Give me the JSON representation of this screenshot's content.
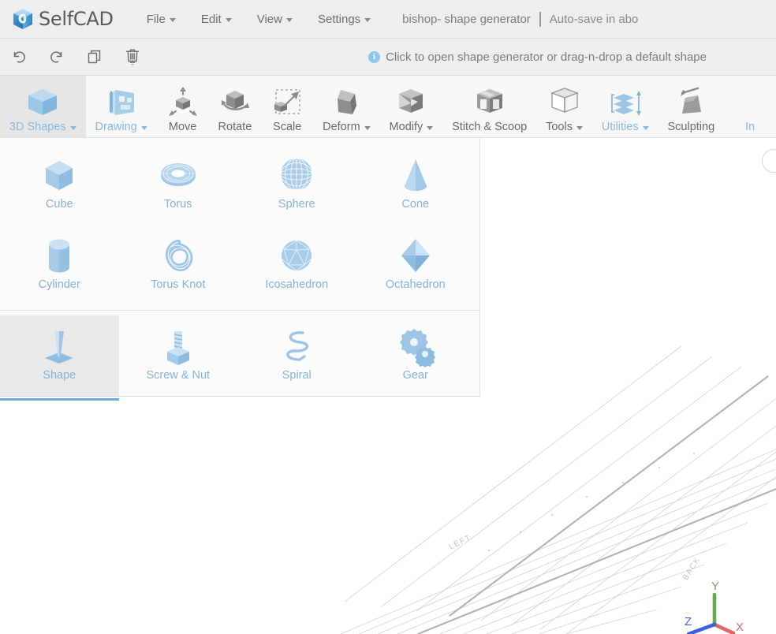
{
  "app": {
    "brand_name": "SelfCAD",
    "logo_icon": "selfcad-cube-logo"
  },
  "menubar": {
    "items": [
      {
        "label": "File",
        "has_caret": true,
        "name": "menu-file"
      },
      {
        "label": "Edit",
        "has_caret": true,
        "name": "menu-edit"
      },
      {
        "label": "View",
        "has_caret": true,
        "name": "menu-view"
      },
      {
        "label": "Settings",
        "has_caret": true,
        "name": "menu-settings"
      }
    ],
    "document_title": "bishop- shape generator",
    "autosave_text": "Auto-save in abo"
  },
  "actionbar": {
    "buttons": [
      {
        "icon": "undo-icon",
        "name": "undo-button",
        "label": "Undo"
      },
      {
        "icon": "redo-icon",
        "name": "redo-button",
        "label": "Redo"
      },
      {
        "icon": "copy-icon",
        "name": "duplicate-button",
        "label": "Duplicate"
      },
      {
        "icon": "trash-icon",
        "name": "delete-button",
        "label": "Delete"
      }
    ],
    "hint_text": "Click to open shape generator or drag-n-drop a default shape",
    "hint_icon": "info-icon"
  },
  "ribbon": {
    "items": [
      {
        "label": "3D Shapes",
        "icon": "cube-icon",
        "caret": true,
        "active": true,
        "blue": true
      },
      {
        "label": "Drawing",
        "icon": "drawing-icon",
        "caret": true,
        "active": false,
        "blue": true
      },
      {
        "label": "Move",
        "icon": "move-icon",
        "caret": false,
        "active": false,
        "blue": false
      },
      {
        "label": "Rotate",
        "icon": "rotate-icon",
        "caret": false,
        "active": false,
        "blue": false
      },
      {
        "label": "Scale",
        "icon": "scale-icon",
        "caret": false,
        "active": false,
        "blue": false
      },
      {
        "label": "Deform",
        "icon": "deform-icon",
        "caret": true,
        "active": false,
        "blue": false
      },
      {
        "label": "Modify",
        "icon": "modify-icon",
        "caret": true,
        "active": false,
        "blue": false
      },
      {
        "label": "Stitch & Scoop",
        "icon": "stitch-scoop-icon",
        "caret": false,
        "active": false,
        "blue": false
      },
      {
        "label": "Tools",
        "icon": "tools-icon",
        "caret": true,
        "active": false,
        "blue": false
      },
      {
        "label": "Utilities",
        "icon": "utilities-icon",
        "caret": true,
        "active": false,
        "blue": true
      },
      {
        "label": "Sculpting",
        "icon": "sculpting-icon",
        "caret": false,
        "active": false,
        "blue": false
      },
      {
        "label": "In",
        "icon": "image-3d-icon",
        "caret": false,
        "active": false,
        "blue": true
      }
    ]
  },
  "shapes_panel": {
    "primitives": [
      {
        "label": "Cube",
        "icon": "cube-shape-icon"
      },
      {
        "label": "Torus",
        "icon": "torus-shape-icon"
      },
      {
        "label": "Sphere",
        "icon": "sphere-shape-icon"
      },
      {
        "label": "Cone",
        "icon": "cone-shape-icon"
      },
      {
        "label": "Cylinder",
        "icon": "cylinder-shape-icon"
      },
      {
        "label": "Torus Knot",
        "icon": "torus-knot-shape-icon"
      },
      {
        "label": "Icosahedron",
        "icon": "icosahedron-shape-icon"
      },
      {
        "label": "Octahedron",
        "icon": "octahedron-shape-icon"
      }
    ],
    "generators": [
      {
        "label": "Shape",
        "icon": "shape-generator-icon",
        "selected": true
      },
      {
        "label": "Screw & Nut",
        "icon": "screw-nut-icon",
        "selected": false
      },
      {
        "label": "Spiral",
        "icon": "spiral-icon",
        "selected": false
      },
      {
        "label": "Gear",
        "icon": "gear-shape-icon",
        "selected": false
      }
    ]
  },
  "viewport": {
    "grid_labels": [
      {
        "text": "LEFT",
        "name": "grid-label-left"
      },
      {
        "text": "BACK",
        "name": "grid-label-back"
      }
    ],
    "axis_gizmo": {
      "x_label": "X",
      "x_color": "#e06666",
      "y_label": "Y",
      "y_color": "#6aa84f",
      "z_label": "Z",
      "z_color": "#3c5fe0"
    }
  },
  "colors": {
    "accent_blue": "#86b3d6",
    "menubar_bg": "#eeeeee",
    "ribbon_bg": "#f7f7f7",
    "panel_bg": "#fbfbfb",
    "text_gray": "#6d6d6d"
  }
}
